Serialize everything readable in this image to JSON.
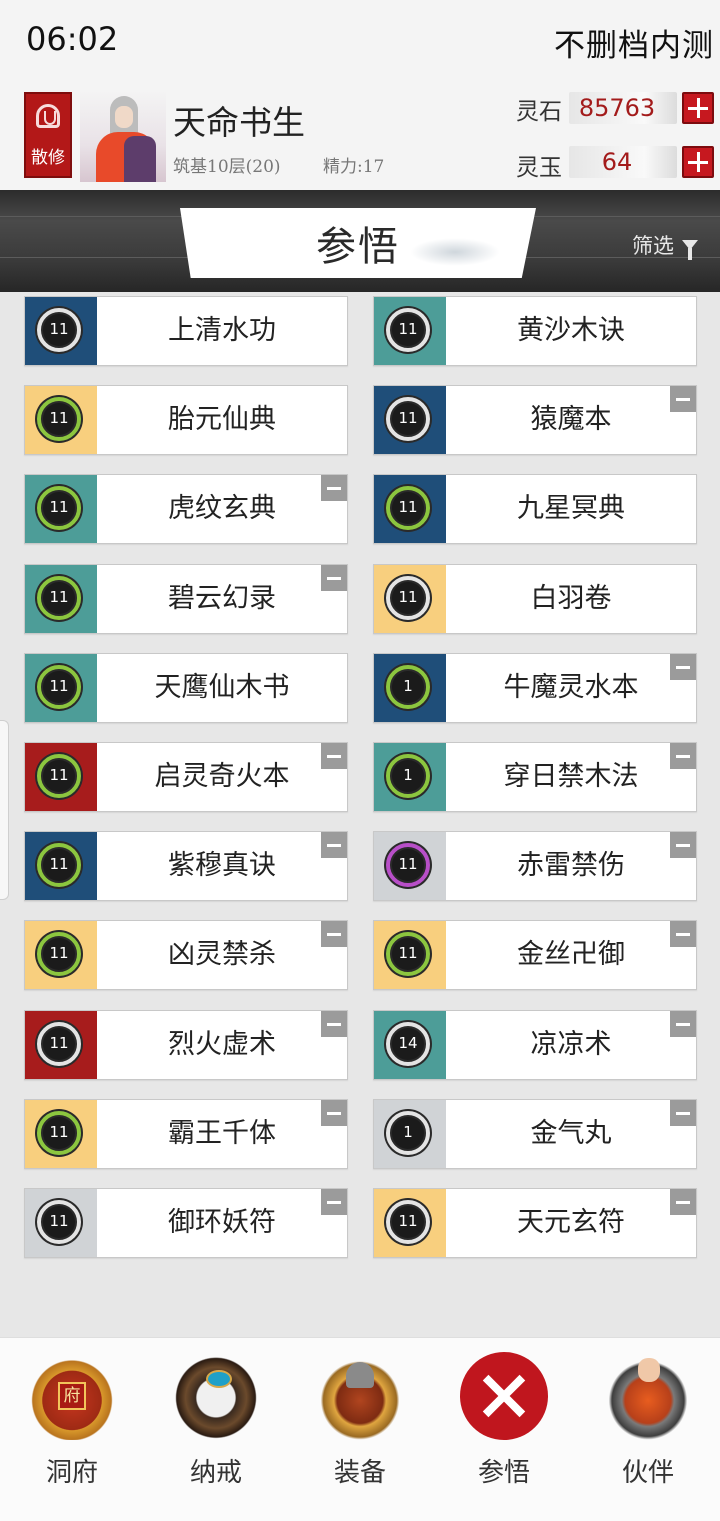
{
  "status_bar": {
    "time": "06:02",
    "build_label": "不删档内测"
  },
  "player": {
    "sect": "散修",
    "name": "天命书生",
    "realm": "筑基10层(20)",
    "energy": "精力:17"
  },
  "currency": [
    {
      "label": "灵石",
      "value": "85763"
    },
    {
      "label": "灵玉",
      "value": "64"
    }
  ],
  "header": {
    "title": "参悟",
    "filter_label": "筛选"
  },
  "swatch_colors": {
    "blue": "#1f4e79",
    "teal": "#4d9d98",
    "yellow": "#f8cf7e",
    "red": "#a71c1c",
    "gray": "#d0d3d6"
  },
  "ring_colors": {
    "gray": "#e4e4e4",
    "green": "#8cc63f",
    "purple": "#b84fc8"
  },
  "skills": [
    {
      "name": "上清水功",
      "level": "11",
      "swatch": "blue",
      "ring": "gray",
      "removable": false
    },
    {
      "name": "黄沙木诀",
      "level": "11",
      "swatch": "teal",
      "ring": "gray",
      "removable": false
    },
    {
      "name": "胎元仙典",
      "level": "11",
      "swatch": "yellow",
      "ring": "green",
      "removable": false
    },
    {
      "name": "猿魔本",
      "level": "11",
      "swatch": "blue",
      "ring": "gray",
      "removable": true
    },
    {
      "name": "虎纹玄典",
      "level": "11",
      "swatch": "teal",
      "ring": "green",
      "removable": true
    },
    {
      "name": "九星冥典",
      "level": "11",
      "swatch": "blue",
      "ring": "green",
      "removable": false
    },
    {
      "name": "碧云幻录",
      "level": "11",
      "swatch": "teal",
      "ring": "green",
      "removable": true
    },
    {
      "name": "白羽卷",
      "level": "11",
      "swatch": "yellow",
      "ring": "gray",
      "removable": false
    },
    {
      "name": "天鹰仙木书",
      "level": "11",
      "swatch": "teal",
      "ring": "green",
      "removable": false
    },
    {
      "name": "牛魔灵水本",
      "level": "1",
      "swatch": "blue",
      "ring": "green",
      "removable": true
    },
    {
      "name": "启灵奇火本",
      "level": "11",
      "swatch": "red",
      "ring": "green",
      "removable": true
    },
    {
      "name": "穿日禁木法",
      "level": "1",
      "swatch": "teal",
      "ring": "green",
      "removable": true
    },
    {
      "name": "紫穆真诀",
      "level": "11",
      "swatch": "blue",
      "ring": "green",
      "removable": true
    },
    {
      "name": "赤雷禁伤",
      "level": "11",
      "swatch": "gray",
      "ring": "purple",
      "removable": true
    },
    {
      "name": "凶灵禁杀",
      "level": "11",
      "swatch": "yellow",
      "ring": "green",
      "removable": true
    },
    {
      "name": "金丝卍御",
      "level": "11",
      "swatch": "yellow",
      "ring": "green",
      "removable": true
    },
    {
      "name": "烈火虚术",
      "level": "11",
      "swatch": "red",
      "ring": "gray",
      "removable": true
    },
    {
      "name": "凉凉术",
      "level": "14",
      "swatch": "teal",
      "ring": "gray",
      "removable": true
    },
    {
      "name": "霸王千体",
      "level": "11",
      "swatch": "yellow",
      "ring": "green",
      "removable": true
    },
    {
      "name": "金气丸",
      "level": "1",
      "swatch": "gray",
      "ring": "gray",
      "removable": true
    },
    {
      "name": "御环妖符",
      "level": "11",
      "swatch": "gray",
      "ring": "gray",
      "removable": true
    },
    {
      "name": "天元玄符",
      "level": "11",
      "swatch": "yellow",
      "ring": "gray",
      "removable": true
    }
  ],
  "bottom_nav": [
    {
      "label": "洞府",
      "icon": "cave-abode-icon",
      "icon_text": "府",
      "active": false
    },
    {
      "label": "纳戒",
      "icon": "storage-ring-icon",
      "active": false
    },
    {
      "label": "装备",
      "icon": "equipment-helmet-icon",
      "active": false
    },
    {
      "label": "参悟",
      "icon": "close-icon",
      "active": true
    },
    {
      "label": "伙伴",
      "icon": "partner-icon",
      "active": false
    }
  ]
}
